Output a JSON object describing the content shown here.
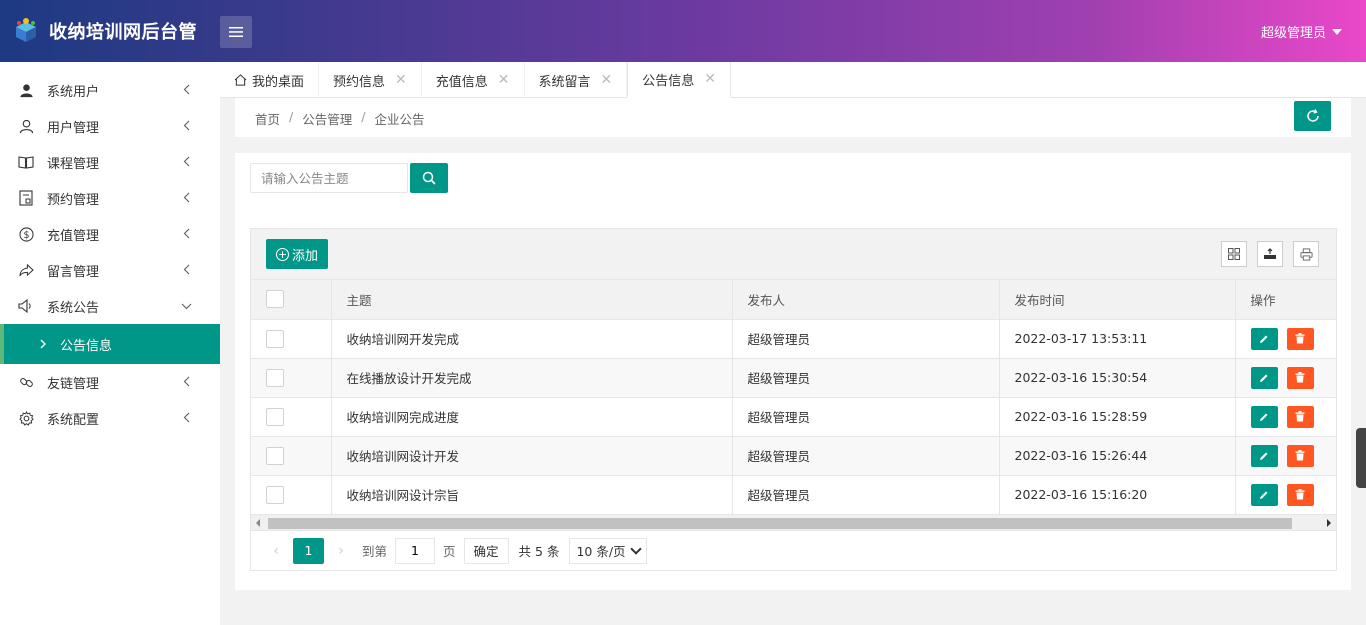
{
  "header": {
    "app_title": "收纳培训网后台管",
    "user_name": "超级管理员",
    "gradient_colors": [
      "#1d3a82",
      "#6a3aa0",
      "#ea48c8"
    ]
  },
  "sidebar": {
    "items": [
      {
        "label": "系统用户",
        "icon": "user-filled-icon"
      },
      {
        "label": "用户管理",
        "icon": "user-outline-icon"
      },
      {
        "label": "课程管理",
        "icon": "book-icon"
      },
      {
        "label": "预约管理",
        "icon": "calendar-icon"
      },
      {
        "label": "充值管理",
        "icon": "dollar-icon"
      },
      {
        "label": "留言管理",
        "icon": "share-arrow-icon"
      },
      {
        "label": "系统公告",
        "icon": "speaker-icon",
        "expanded": true
      },
      {
        "label": "友链管理",
        "icon": "link-icon"
      },
      {
        "label": "系统配置",
        "icon": "gear-icon"
      }
    ],
    "active_sub": "公告信息"
  },
  "tabs": [
    {
      "label": "我的桌面",
      "icon": "home-icon",
      "closable": false
    },
    {
      "label": "预约信息",
      "closable": true
    },
    {
      "label": "充值信息",
      "closable": true
    },
    {
      "label": "系统留言",
      "closable": true
    },
    {
      "label": "公告信息",
      "closable": true,
      "active": true
    }
  ],
  "breadcrumb": [
    "首页",
    "公告管理",
    "企业公告"
  ],
  "search": {
    "placeholder": "请输入公告主题",
    "value": ""
  },
  "toolbar": {
    "add_label": "添加"
  },
  "table": {
    "columns": [
      "主题",
      "发布人",
      "发布时间",
      "操作"
    ],
    "rows": [
      {
        "title": "收纳培训网开发完成",
        "publisher": "超级管理员",
        "time": "2022-03-17 13:53:11"
      },
      {
        "title": "在线播放设计开发完成",
        "publisher": "超级管理员",
        "time": "2022-03-16 15:30:54"
      },
      {
        "title": "收纳培训网完成进度",
        "publisher": "超级管理员",
        "time": "2022-03-16 15:28:59"
      },
      {
        "title": "收纳培训网设计开发",
        "publisher": "超级管理员",
        "time": "2022-03-16 15:26:44"
      },
      {
        "title": "收纳培训网设计宗旨",
        "publisher": "超级管理员",
        "time": "2022-03-16 15:16:20"
      }
    ]
  },
  "pager": {
    "current": "1",
    "goto_prefix": "到第",
    "goto_value": "1",
    "goto_suffix": "页",
    "confirm_label": "确定",
    "total": "共 5 条",
    "page_size": "10 条/页"
  },
  "colors": {
    "primary": "#009688",
    "danger": "#ff5722"
  }
}
